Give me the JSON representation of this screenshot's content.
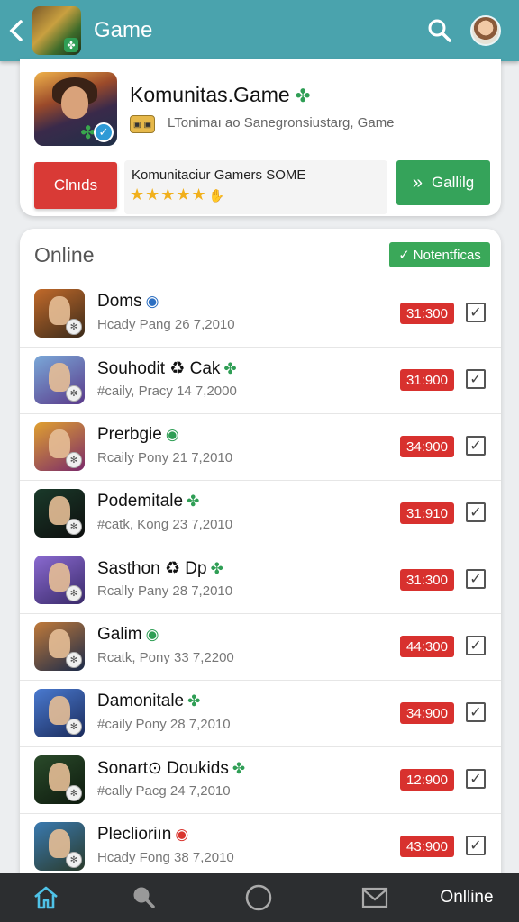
{
  "header": {
    "title": "Game",
    "back_icon": "chevron-left-icon",
    "search_icon": "search-icon",
    "profile_icon": "avatar",
    "color": "#4aa3ad"
  },
  "featured": {
    "title": "Komunitas.Game",
    "subtitle": "LTonimaı ao Sanegronsiustarg, Game",
    "red_button": "Clnıds",
    "info_text": "Komunitaciur Gamers SOME",
    "green_button": "Gallilg"
  },
  "online": {
    "title": "Online",
    "notif_button": "Notentficas",
    "rows": [
      {
        "name": "Doms",
        "meta": "Hcady Pang 26 7,2010",
        "price": "31:300",
        "icon": "◉",
        "icon_color": "#2c6fc2",
        "colors": [
          "#c26a2a",
          "#3a2a1a"
        ]
      },
      {
        "name": "Souhodit ♻ Cak",
        "meta": "#caily, Pracy 14 7,2000",
        "price": "31:900",
        "icon": "✤",
        "icon_color": "#2f9e55",
        "colors": [
          "#7aa8d8",
          "#5a3a8a"
        ]
      },
      {
        "name": "Prerbgie",
        "meta": "Rcaily Pony 21 7,2010",
        "price": "34:900",
        "icon": "◉",
        "icon_color": "#2f9e55",
        "colors": [
          "#e0a030",
          "#7a2a6a"
        ]
      },
      {
        "name": "Podemitale",
        "meta": "#catk, Kong 23 7,2010",
        "price": "31:910",
        "icon": "✤",
        "icon_color": "#2f9e55",
        "colors": [
          "#1a3a2a",
          "#0e0e0e"
        ]
      },
      {
        "name": "Sasthon ♻ Dp",
        "meta": "Rcally Pany 28 7,2010",
        "price": "31:300",
        "icon": "✤",
        "icon_color": "#2f9e55",
        "colors": [
          "#8a6ad0",
          "#3a2a6a"
        ]
      },
      {
        "name": "Galim",
        "meta": "Rcatk, Pony 33 7,2200",
        "price": "44:300",
        "icon": "◉",
        "icon_color": "#2f9e55",
        "colors": [
          "#c07a3a",
          "#1a2a4a"
        ]
      },
      {
        "name": "Damonitale",
        "meta": "#caily Pony 28 7,2010",
        "price": "34:900",
        "icon": "✤",
        "icon_color": "#2f9e55",
        "colors": [
          "#4a7ad0",
          "#1a2a5a"
        ]
      },
      {
        "name": "Sonart⊙ Doukids",
        "meta": "#cally Pacg 24 7,2010",
        "price": "12:900",
        "icon": "✤",
        "icon_color": "#2f9e55",
        "colors": [
          "#2a4a2a",
          "#0e1a0e"
        ]
      },
      {
        "name": "Pleclioriın",
        "meta": "Hcady Fong 38 7,2010",
        "price": "43:900",
        "icon": "◉",
        "icon_color": "#d9352f",
        "colors": [
          "#3a7ab0",
          "#2a3a2a"
        ]
      }
    ]
  },
  "nav": {
    "home_icon": "home-icon",
    "search_icon": "search-icon",
    "circle_icon": "circle-icon",
    "mail_icon": "mail-icon",
    "label": "Onlline"
  }
}
